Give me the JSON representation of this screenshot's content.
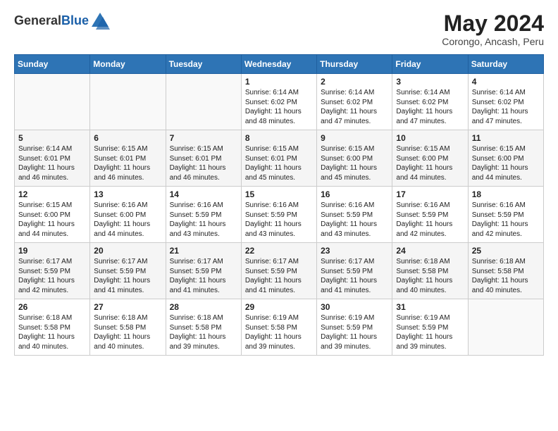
{
  "logo": {
    "general": "General",
    "blue": "Blue"
  },
  "header": {
    "month": "May 2024",
    "location": "Corongo, Ancash, Peru"
  },
  "days_of_week": [
    "Sunday",
    "Monday",
    "Tuesday",
    "Wednesday",
    "Thursday",
    "Friday",
    "Saturday"
  ],
  "weeks": [
    [
      {
        "day": "",
        "info": ""
      },
      {
        "day": "",
        "info": ""
      },
      {
        "day": "",
        "info": ""
      },
      {
        "day": "1",
        "info": "Sunrise: 6:14 AM\nSunset: 6:02 PM\nDaylight: 11 hours\nand 48 minutes."
      },
      {
        "day": "2",
        "info": "Sunrise: 6:14 AM\nSunset: 6:02 PM\nDaylight: 11 hours\nand 47 minutes."
      },
      {
        "day": "3",
        "info": "Sunrise: 6:14 AM\nSunset: 6:02 PM\nDaylight: 11 hours\nand 47 minutes."
      },
      {
        "day": "4",
        "info": "Sunrise: 6:14 AM\nSunset: 6:02 PM\nDaylight: 11 hours\nand 47 minutes."
      }
    ],
    [
      {
        "day": "5",
        "info": "Sunrise: 6:14 AM\nSunset: 6:01 PM\nDaylight: 11 hours\nand 46 minutes."
      },
      {
        "day": "6",
        "info": "Sunrise: 6:15 AM\nSunset: 6:01 PM\nDaylight: 11 hours\nand 46 minutes."
      },
      {
        "day": "7",
        "info": "Sunrise: 6:15 AM\nSunset: 6:01 PM\nDaylight: 11 hours\nand 46 minutes."
      },
      {
        "day": "8",
        "info": "Sunrise: 6:15 AM\nSunset: 6:01 PM\nDaylight: 11 hours\nand 45 minutes."
      },
      {
        "day": "9",
        "info": "Sunrise: 6:15 AM\nSunset: 6:00 PM\nDaylight: 11 hours\nand 45 minutes."
      },
      {
        "day": "10",
        "info": "Sunrise: 6:15 AM\nSunset: 6:00 PM\nDaylight: 11 hours\nand 44 minutes."
      },
      {
        "day": "11",
        "info": "Sunrise: 6:15 AM\nSunset: 6:00 PM\nDaylight: 11 hours\nand 44 minutes."
      }
    ],
    [
      {
        "day": "12",
        "info": "Sunrise: 6:15 AM\nSunset: 6:00 PM\nDaylight: 11 hours\nand 44 minutes."
      },
      {
        "day": "13",
        "info": "Sunrise: 6:16 AM\nSunset: 6:00 PM\nDaylight: 11 hours\nand 44 minutes."
      },
      {
        "day": "14",
        "info": "Sunrise: 6:16 AM\nSunset: 5:59 PM\nDaylight: 11 hours\nand 43 minutes."
      },
      {
        "day": "15",
        "info": "Sunrise: 6:16 AM\nSunset: 5:59 PM\nDaylight: 11 hours\nand 43 minutes."
      },
      {
        "day": "16",
        "info": "Sunrise: 6:16 AM\nSunset: 5:59 PM\nDaylight: 11 hours\nand 43 minutes."
      },
      {
        "day": "17",
        "info": "Sunrise: 6:16 AM\nSunset: 5:59 PM\nDaylight: 11 hours\nand 42 minutes."
      },
      {
        "day": "18",
        "info": "Sunrise: 6:16 AM\nSunset: 5:59 PM\nDaylight: 11 hours\nand 42 minutes."
      }
    ],
    [
      {
        "day": "19",
        "info": "Sunrise: 6:17 AM\nSunset: 5:59 PM\nDaylight: 11 hours\nand 42 minutes."
      },
      {
        "day": "20",
        "info": "Sunrise: 6:17 AM\nSunset: 5:59 PM\nDaylight: 11 hours\nand 41 minutes."
      },
      {
        "day": "21",
        "info": "Sunrise: 6:17 AM\nSunset: 5:59 PM\nDaylight: 11 hours\nand 41 minutes."
      },
      {
        "day": "22",
        "info": "Sunrise: 6:17 AM\nSunset: 5:59 PM\nDaylight: 11 hours\nand 41 minutes."
      },
      {
        "day": "23",
        "info": "Sunrise: 6:17 AM\nSunset: 5:59 PM\nDaylight: 11 hours\nand 41 minutes."
      },
      {
        "day": "24",
        "info": "Sunrise: 6:18 AM\nSunset: 5:58 PM\nDaylight: 11 hours\nand 40 minutes."
      },
      {
        "day": "25",
        "info": "Sunrise: 6:18 AM\nSunset: 5:58 PM\nDaylight: 11 hours\nand 40 minutes."
      }
    ],
    [
      {
        "day": "26",
        "info": "Sunrise: 6:18 AM\nSunset: 5:58 PM\nDaylight: 11 hours\nand 40 minutes."
      },
      {
        "day": "27",
        "info": "Sunrise: 6:18 AM\nSunset: 5:58 PM\nDaylight: 11 hours\nand 40 minutes."
      },
      {
        "day": "28",
        "info": "Sunrise: 6:18 AM\nSunset: 5:58 PM\nDaylight: 11 hours\nand 39 minutes."
      },
      {
        "day": "29",
        "info": "Sunrise: 6:19 AM\nSunset: 5:58 PM\nDaylight: 11 hours\nand 39 minutes."
      },
      {
        "day": "30",
        "info": "Sunrise: 6:19 AM\nSunset: 5:59 PM\nDaylight: 11 hours\nand 39 minutes."
      },
      {
        "day": "31",
        "info": "Sunrise: 6:19 AM\nSunset: 5:59 PM\nDaylight: 11 hours\nand 39 minutes."
      },
      {
        "day": "",
        "info": ""
      }
    ]
  ]
}
